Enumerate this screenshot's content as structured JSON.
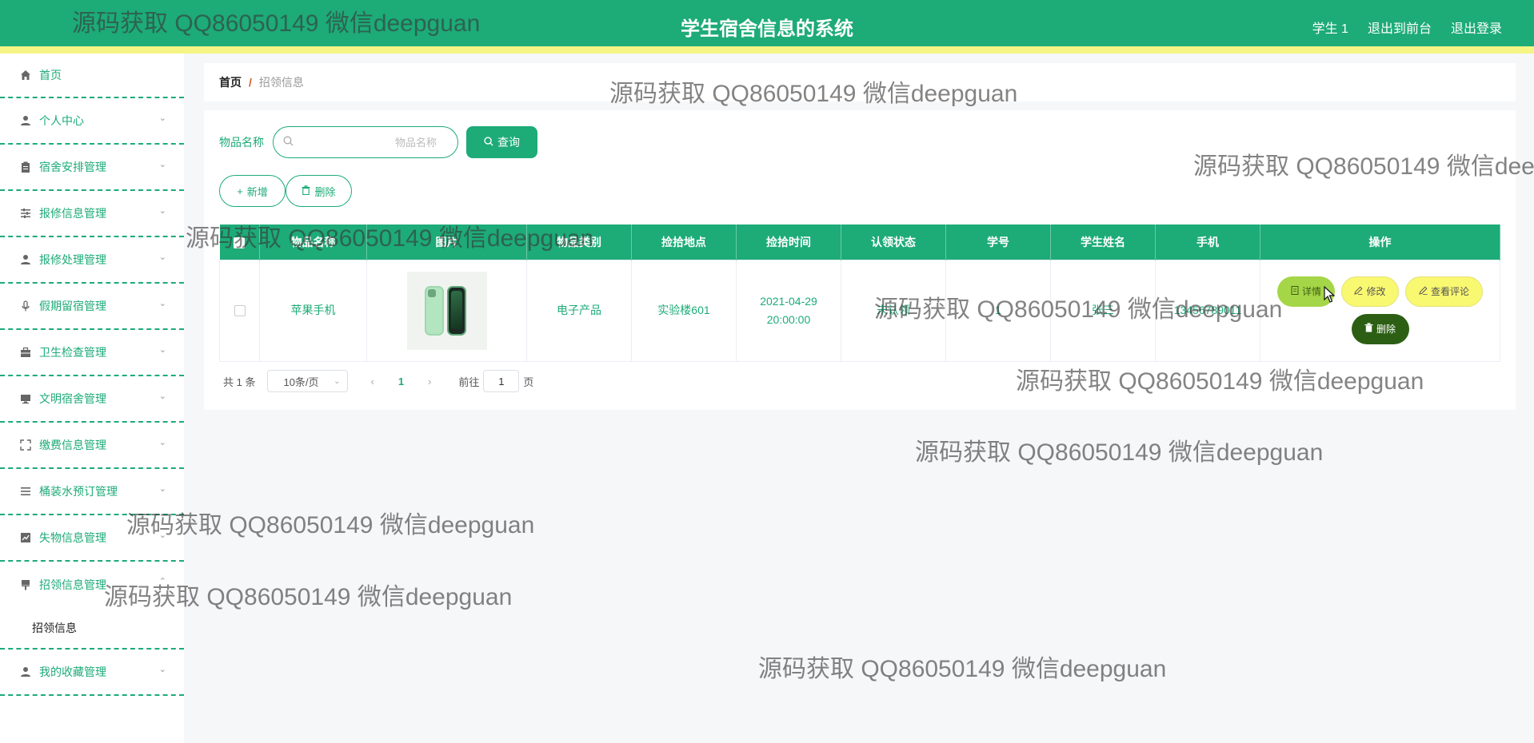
{
  "header": {
    "title": "学生宿舍信息的系统",
    "user": "学生 1",
    "to_front": "退出到前台",
    "logout": "退出登录"
  },
  "sidebar": {
    "items": [
      {
        "label": "首页",
        "icon": "home-icon"
      },
      {
        "label": "个人中心",
        "icon": "user-icon"
      },
      {
        "label": "宿舍安排管理",
        "icon": "clipboard-icon"
      },
      {
        "label": "报修信息管理",
        "icon": "sliders-icon"
      },
      {
        "label": "报修处理管理",
        "icon": "user-icon"
      },
      {
        "label": "假期留宿管理",
        "icon": "microphone-icon"
      },
      {
        "label": "卫生检查管理",
        "icon": "briefcase-icon"
      },
      {
        "label": "文明宿舍管理",
        "icon": "monitor-icon"
      },
      {
        "label": "缴费信息管理",
        "icon": "fullscreen-icon"
      },
      {
        "label": "桶装水预订管理",
        "icon": "list-icon"
      },
      {
        "label": "失物信息管理",
        "icon": "chart-icon"
      },
      {
        "label": "招领信息管理",
        "icon": "brush-icon"
      },
      {
        "label": "我的收藏管理",
        "icon": "user-icon"
      }
    ],
    "active_sub": "招领信息"
  },
  "breadcrumb": {
    "home": "首页",
    "sep": "/",
    "current": "招领信息"
  },
  "search": {
    "label": "物品名称",
    "placeholder": "物品名称",
    "value": "",
    "button": "查询"
  },
  "actions": {
    "add": "新增",
    "delete": "删除"
  },
  "table": {
    "headers": [
      "物品名称",
      "图片",
      "物品类别",
      "捡拾地点",
      "捡拾时间",
      "认领状态",
      "学号",
      "学生姓名",
      "手机",
      "操作"
    ],
    "rows": [
      {
        "name": "苹果手机",
        "image": "green-iphone",
        "category": "电子产品",
        "location": "实验楼601",
        "time": "2021-04-29 20:00:00",
        "status": "未认领",
        "student_no": "1",
        "student_name": "张三",
        "phone": "13456789011",
        "ops": {
          "detail": "详情",
          "edit": "修改",
          "comment": "查看评论",
          "delete": "删除"
        }
      }
    ]
  },
  "pager": {
    "total": "共 1 条",
    "page_size": "10条/页",
    "current": "1",
    "goto_label": "前往",
    "goto_value": "1",
    "page_unit": "页"
  },
  "watermark": "源码获取 QQ86050149 微信deepguan",
  "colors": {
    "primary": "#1dab78",
    "accent_strip": "#f5f586",
    "detail_btn": "#a5d647",
    "edit_btn": "#f9f871",
    "delete_btn": "#2c5f14"
  }
}
